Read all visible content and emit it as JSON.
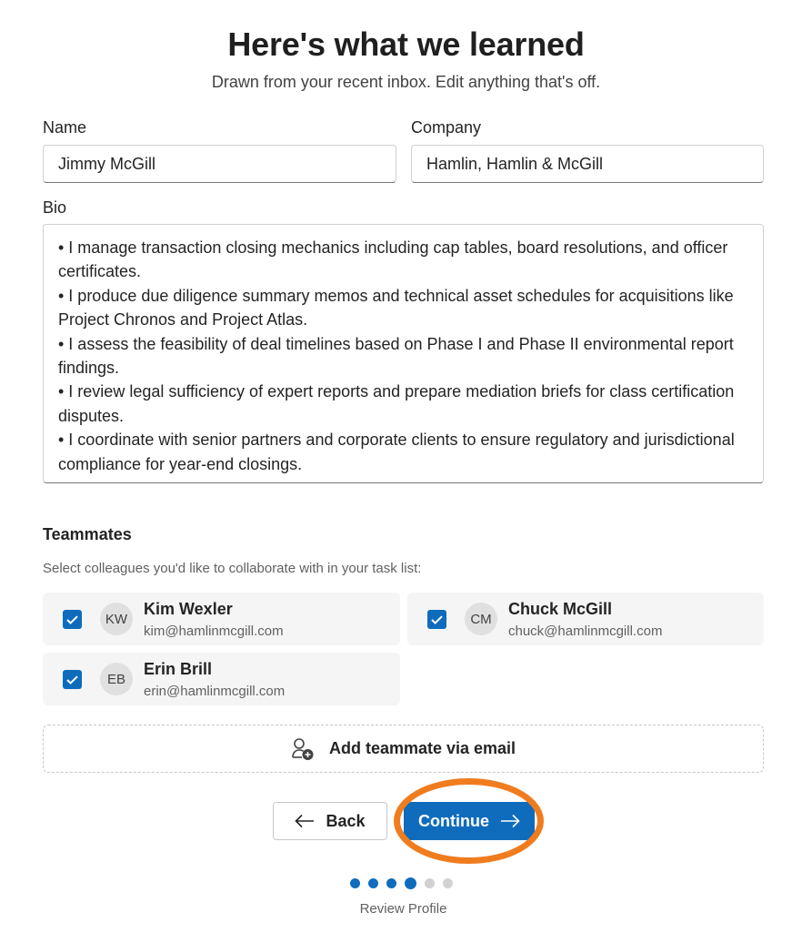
{
  "header": {
    "title": "Here's what we learned",
    "subtitle": "Drawn from your recent inbox. Edit anything that's off."
  },
  "form": {
    "name_label": "Name",
    "name_value": "Jimmy McGill",
    "company_label": "Company",
    "company_value": "Hamlin, Hamlin & McGill",
    "bio_label": "Bio",
    "bio_value": "• I manage transaction closing mechanics including cap tables, board resolutions, and officer certificates.\n• I produce due diligence summary memos and technical asset schedules for acquisitions like Project Chronos and Project Atlas.\n• I assess the feasibility of deal timelines based on Phase I and Phase II environmental report findings.\n• I review legal sufficiency of expert reports and prepare mediation briefs for class certification disputes.\n• I coordinate with senior partners and corporate clients to ensure regulatory and jurisdictional compliance for year-end closings."
  },
  "teammates": {
    "title": "Teammates",
    "description": "Select colleagues you'd like to collaborate with in your task list:",
    "items": [
      {
        "initials": "KW",
        "name": "Kim Wexler",
        "email": "kim@hamlinmcgill.com",
        "checked": true
      },
      {
        "initials": "CM",
        "name": "Chuck McGill",
        "email": "chuck@hamlinmcgill.com",
        "checked": true
      },
      {
        "initials": "EB",
        "name": "Erin Brill",
        "email": "erin@hamlinmcgill.com",
        "checked": true
      }
    ],
    "add_label": "Add teammate via email",
    "add_icon": "person-add-icon"
  },
  "nav": {
    "back_label": "Back",
    "back_icon": "arrow-left-icon",
    "continue_label": "Continue",
    "continue_icon": "arrow-right-icon",
    "highlight_color": "#f07c1e"
  },
  "progress": {
    "total_steps": 6,
    "current_step": 4,
    "step_label": "Review Profile"
  },
  "colors": {
    "accent": "#0f6cbd",
    "inactive_dot": "#d1d1d1"
  }
}
